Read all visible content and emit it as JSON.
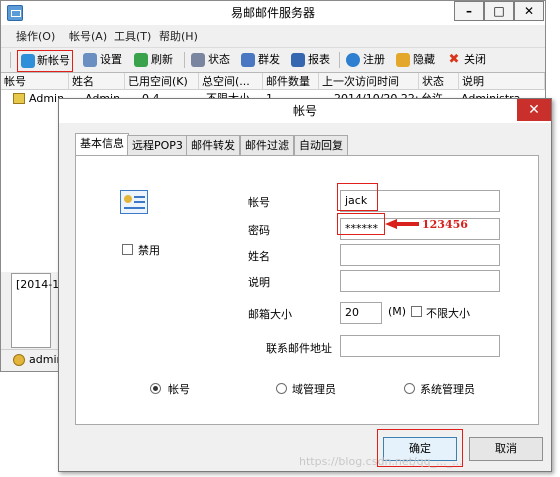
{
  "main_window": {
    "title": "易邮邮件服务器",
    "menu": [
      "操作(O)",
      "帐号(A)",
      "工具(T)",
      "帮助(H)"
    ],
    "toolbar": [
      "新帐号",
      "设置",
      "刷新",
      "状态",
      "群发",
      "报表",
      "注册",
      "隐藏",
      "关闭"
    ],
    "columns": [
      "帐号",
      "姓名",
      "已用空间(K)",
      "总空间(...",
      "邮件数量",
      "上一次访问时间",
      "状态",
      "说明"
    ],
    "row": [
      "Admin",
      "Admin",
      "0.4",
      "不限大小",
      "1",
      "2014/10/20 22:1",
      "允许",
      "Administra"
    ],
    "log_text": "[2014-1(",
    "status_account": "admin"
  },
  "dialog": {
    "title": "帐号",
    "tabs": [
      "基本信息",
      "远程POP3",
      "邮件转发",
      "邮件过滤",
      "自动回复"
    ],
    "labels": {
      "account": "帐号",
      "password": "密码",
      "name": "姓名",
      "description": "说明",
      "mailbox_size": "邮箱大小",
      "unit": "(M)",
      "unlimited": "不限大小",
      "contact": "联系邮件地址",
      "disable": "禁用"
    },
    "values": {
      "account": "jack",
      "password": "******",
      "name": "",
      "description": "",
      "mailbox_size": "20",
      "contact": ""
    },
    "roles": [
      "帐号",
      "域管理员",
      "系统管理员"
    ],
    "selected_role": "帐号",
    "buttons": {
      "ok": "确定",
      "cancel": "取消"
    }
  },
  "annotation": {
    "password_hint": "123456"
  },
  "watermark": "https://blog.csdn.net/qq_..._..."
}
